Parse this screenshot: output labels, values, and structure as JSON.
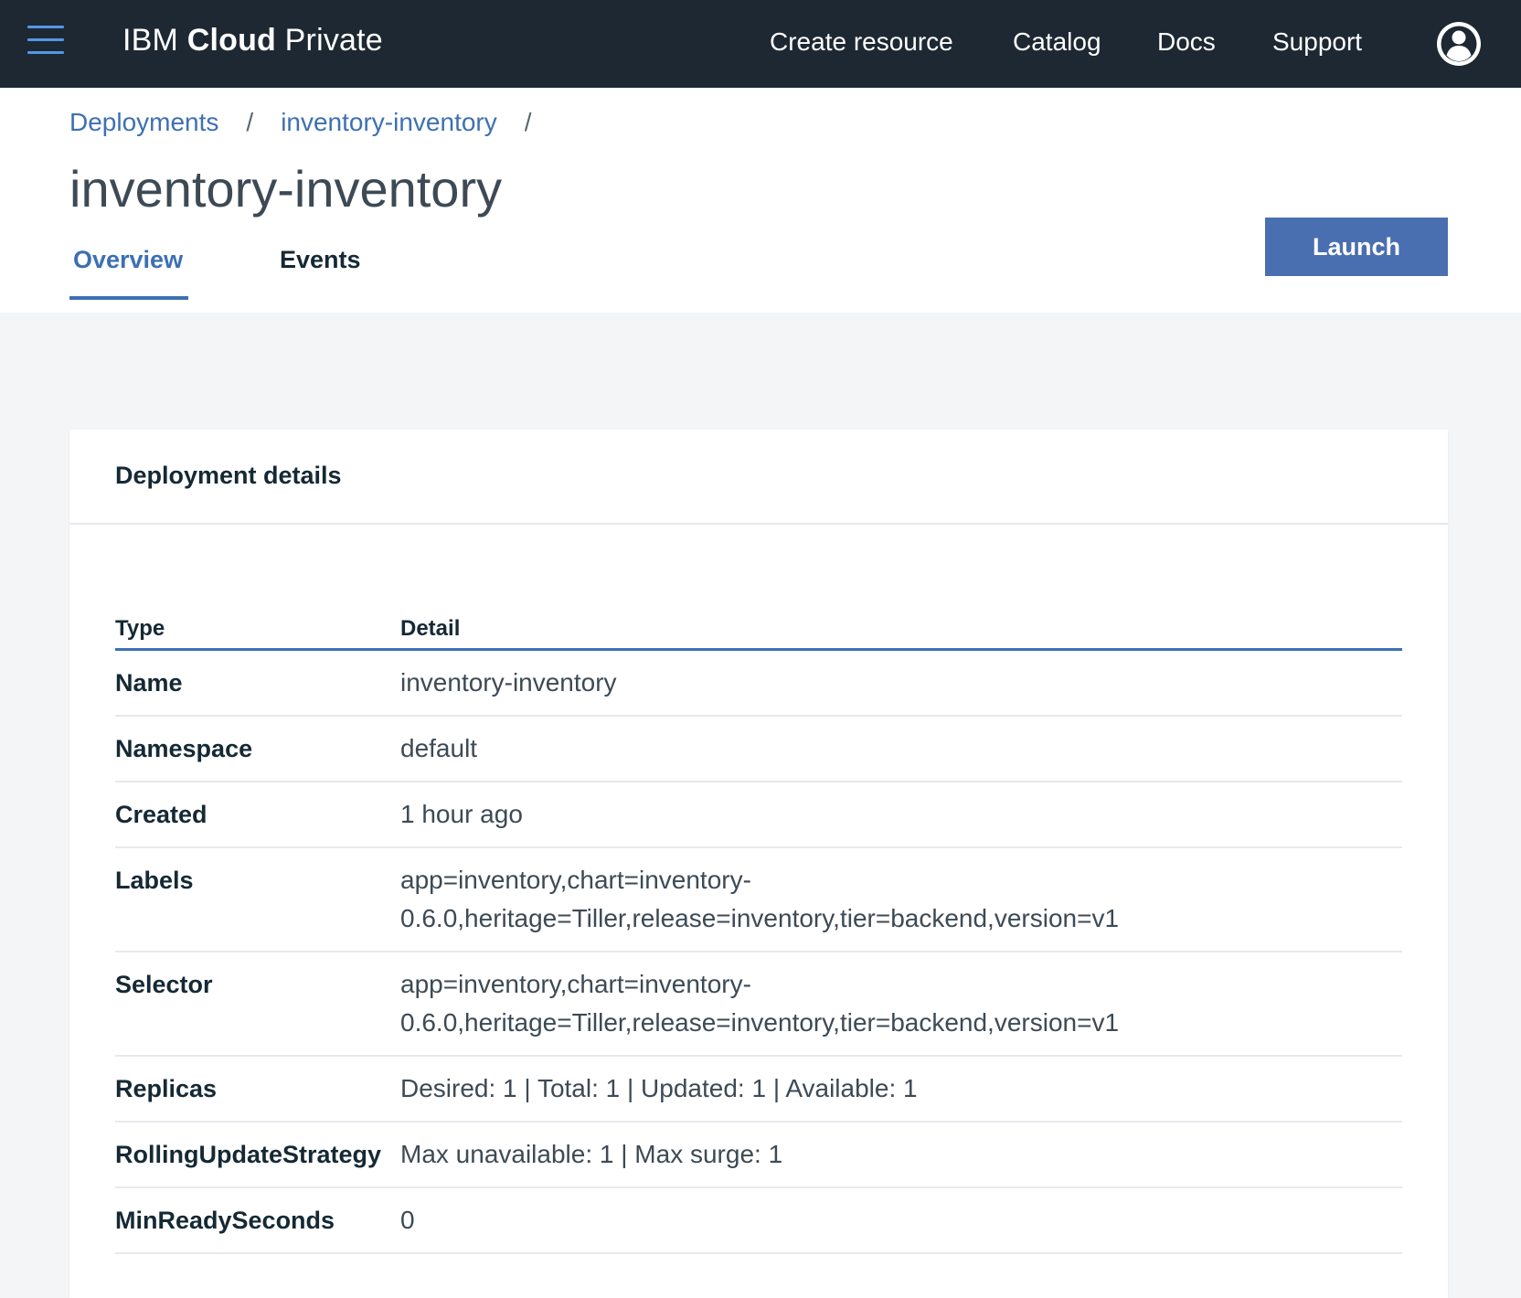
{
  "header": {
    "brand_prefix": "IBM",
    "brand_bold": "Cloud",
    "brand_suffix": "Private",
    "nav": {
      "create_resource": "Create resource",
      "catalog": "Catalog",
      "docs": "Docs",
      "support": "Support"
    }
  },
  "breadcrumb": {
    "items": [
      "Deployments",
      "inventory-inventory"
    ],
    "separator": "/"
  },
  "page": {
    "title": "inventory-inventory",
    "tabs": [
      "Overview",
      "Events"
    ],
    "active_tab": "Overview",
    "launch_label": "Launch"
  },
  "card": {
    "title": "Deployment details",
    "columns": [
      "Type",
      "Detail"
    ],
    "rows": [
      {
        "type": "Name",
        "detail": "inventory-inventory"
      },
      {
        "type": "Namespace",
        "detail": "default"
      },
      {
        "type": "Created",
        "detail": "1 hour ago"
      },
      {
        "type": "Labels",
        "detail": "app=inventory,chart=inventory-0.6.0,heritage=Tiller,release=inventory,tier=backend,version=v1"
      },
      {
        "type": "Selector",
        "detail": "app=inventory,chart=inventory-0.6.0,heritage=Tiller,release=inventory,tier=backend,version=v1"
      },
      {
        "type": "Replicas",
        "detail": "Desired: 1 | Total: 1 | Updated: 1 | Available: 1"
      },
      {
        "type": "RollingUpdateStrategy",
        "detail": "Max unavailable: 1 | Max surge: 1"
      },
      {
        "type": "MinReadySeconds",
        "detail": "0"
      }
    ]
  },
  "icons": {
    "menu": "hamburger-menu-icon",
    "user": "user-avatar-icon"
  },
  "colors": {
    "topbar": "#1d2833",
    "accent": "#3d70b2",
    "button": "#4a6fb0",
    "page_bg": "#f4f5f7"
  }
}
